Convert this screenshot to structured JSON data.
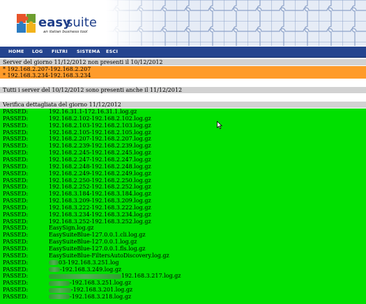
{
  "header": {
    "logo_text": "easysuite",
    "logo_tagline": "an italian business tool"
  },
  "nav": [
    "HOME",
    "LOG",
    "FILTRI",
    "SISTEMA",
    "ESCI"
  ],
  "section1": {
    "title": "Server del giorno 11/12/2012 non presenti il 10/12/2012",
    "items": [
      "* 192.168.2.207-192.168.2.207",
      "* 192.168.3.234-192.168.3.234"
    ]
  },
  "section2": {
    "title": "Tutti i server del 10/12/2012 sono presenti anche il 11/12/2012"
  },
  "section3": {
    "title": "Verifica dettagliata del giorno 11/12/2012",
    "rows": [
      {
        "status": "PASSED:",
        "file": "192.16.31.1-172.16.31.1.log.gz"
      },
      {
        "status": "PASSED:",
        "file": "192.168.2.102-192.168.2.102.log.gz"
      },
      {
        "status": "PASSED:",
        "file": "192.168.2.103-192.168.2.103.log.gz"
      },
      {
        "status": "PASSED:",
        "file": "192.168.2.105-192.168.2.105.log.gz"
      },
      {
        "status": "PASSED:",
        "file": "192.168.2.207-192.168.2.207.log.gz"
      },
      {
        "status": "PASSED:",
        "file": "192.168.2.239-192.168.2.239.log.gz"
      },
      {
        "status": "PASSED:",
        "file": "192.168.2.245-192.168.2.245.log.gz"
      },
      {
        "status": "PASSED:",
        "file": "192.168.2.247-192.168.2.247.log.gz"
      },
      {
        "status": "PASSED:",
        "file": "192.168.2.248-192.168.2.248.log.gz"
      },
      {
        "status": "PASSED:",
        "file": "192.168.2.249-192.168.2.249.log.gz"
      },
      {
        "status": "PASSED:",
        "file": "192.168.2.250-192.168.2.250.log.gz"
      },
      {
        "status": "PASSED:",
        "file": "192.168.2.252-192.168.2.252.log.gz"
      },
      {
        "status": "PASSED:",
        "file": "192.168.3.184-192.168.3.184.log.gz"
      },
      {
        "status": "PASSED:",
        "file": "192.168.3.209-192.168.3.209.log.gz"
      },
      {
        "status": "PASSED:",
        "file": "192.168.3.222-192.168.3.222.log.gz"
      },
      {
        "status": "PASSED:",
        "file": "192.168.3.234-192.168.3.234.log.gz"
      },
      {
        "status": "PASSED:",
        "file": "192.168.3.252-192.168.3.252.log.gz"
      },
      {
        "status": "PASSED:",
        "file": "EasySign.log.gz"
      },
      {
        "status": "PASSED:",
        "file": "EasySuiteBlue-127.0.0.1.cli.log.gz"
      },
      {
        "status": "PASSED:",
        "file": "EasySuiteBlue-127.0.0.1.log.gz"
      },
      {
        "status": "PASSED:",
        "file": "EasySuiteBlue-127.0.0.1.fls.log.gz"
      },
      {
        "status": "PASSED:",
        "file": "EasySuiteBlue-FiltersAutoDiscovery.log.gz"
      },
      {
        "status": "PASSED:",
        "file": "03-192.168.3.251.log"
      },
      {
        "status": "PASSED:",
        "file": "-192.168.3.249.log.gz"
      },
      {
        "status": "PASSED:",
        "file": "192.168.3.217.log.gz"
      },
      {
        "status": "PASSED:",
        "file": "-192.168.3.251.log.gz"
      },
      {
        "status": "PASSED:",
        "file": "-192.168.3.201.log.gz"
      },
      {
        "status": "PASSED:",
        "file": "-192.168.3.218.log.gz"
      }
    ]
  },
  "colors": {
    "nav": "#24448f",
    "section_header": "#d2d2d2",
    "warning": "#ff9b2a",
    "passed": "#00e000"
  }
}
